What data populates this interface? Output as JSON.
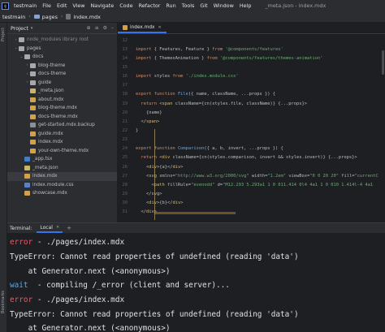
{
  "menubar": {
    "items": [
      "testmain",
      "File",
      "Edit",
      "View",
      "Navigate",
      "Code",
      "Refactor",
      "Run",
      "Tools",
      "Git",
      "Window",
      "Help"
    ],
    "title": "_meta.json - index.mdx"
  },
  "breadcrumb": {
    "items": [
      "testmain",
      "pages",
      "index.mdx"
    ]
  },
  "tool_strip": {
    "top_label": "Project",
    "bottom_label": "Bookmarks"
  },
  "project_panel": {
    "title": "Project",
    "tree": [
      {
        "indent": 1,
        "arrow": "›",
        "icon": "folder-icon",
        "label": "node_modules  library root",
        "dim": true
      },
      {
        "indent": 1,
        "arrow": "⌄",
        "icon": "folder-icon",
        "label": "pages"
      },
      {
        "indent": 2,
        "arrow": "⌄",
        "icon": "folder-icon",
        "label": "docs"
      },
      {
        "indent": 3,
        "arrow": "›",
        "icon": "folder-icon",
        "label": "blog-theme"
      },
      {
        "indent": 3,
        "arrow": "›",
        "icon": "folder-icon",
        "label": "docs-theme"
      },
      {
        "indent": 3,
        "arrow": "›",
        "icon": "folder-icon",
        "label": "guide"
      },
      {
        "indent": 3,
        "arrow": "",
        "icon": "json-icon",
        "label": "_meta.json"
      },
      {
        "indent": 3,
        "arrow": "",
        "icon": "mdx-icon",
        "label": "about.mdx"
      },
      {
        "indent": 3,
        "arrow": "",
        "icon": "mdx-icon",
        "label": "blog-theme.mdx"
      },
      {
        "indent": 3,
        "arrow": "",
        "icon": "mdx-icon",
        "label": "docs-theme.mdx"
      },
      {
        "indent": 3,
        "arrow": "",
        "icon": "backup-icon",
        "label": "get-started.mdx.backup"
      },
      {
        "indent": 3,
        "arrow": "",
        "icon": "mdx-icon",
        "label": "guide.mdx"
      },
      {
        "indent": 3,
        "arrow": "",
        "icon": "mdx-icon",
        "label": "index.mdx"
      },
      {
        "indent": 3,
        "arrow": "",
        "icon": "mdx-icon",
        "label": "your-own-theme.mdx"
      },
      {
        "indent": 2,
        "arrow": "",
        "icon": "ts-icon",
        "label": "_app.tsx"
      },
      {
        "indent": 2,
        "arrow": "",
        "icon": "json-icon",
        "label": "_meta.json"
      },
      {
        "indent": 2,
        "arrow": "",
        "icon": "mdx-icon",
        "label": "index.mdx",
        "selected": true
      },
      {
        "indent": 2,
        "arrow": "",
        "icon": "css-icon",
        "label": "index.module.css"
      },
      {
        "indent": 2,
        "arrow": "",
        "icon": "mdx-icon",
        "label": "showcase.mdx"
      }
    ]
  },
  "editor": {
    "tab_label": "index.mdx",
    "lines": [
      {
        "n": "12",
        "tokens": []
      },
      {
        "n": "13",
        "tokens": [
          {
            "c": "tok-kw",
            "t": "import "
          },
          {
            "c": "",
            "t": "{ Features, Feature } "
          },
          {
            "c": "tok-kw",
            "t": "from "
          },
          {
            "c": "tok-str",
            "t": "'@components/features'"
          }
        ]
      },
      {
        "n": "14",
        "tokens": [
          {
            "c": "tok-kw",
            "t": "import "
          },
          {
            "c": "",
            "t": "{ ThemesAnimation } "
          },
          {
            "c": "tok-kw",
            "t": "from "
          },
          {
            "c": "tok-str",
            "t": "'@components/features/themes-animation'"
          }
        ]
      },
      {
        "n": "15",
        "tokens": []
      },
      {
        "n": "16",
        "tokens": [
          {
            "c": "tok-kw",
            "t": "import "
          },
          {
            "c": "",
            "t": "styles "
          },
          {
            "c": "tok-kw",
            "t": "from "
          },
          {
            "c": "tok-str",
            "t": "'./index.module.css'"
          }
        ]
      },
      {
        "n": "17",
        "tokens": []
      },
      {
        "n": "18",
        "tokens": [
          {
            "c": "tok-kw",
            "t": "export function "
          },
          {
            "c": "tok-fn",
            "t": "File"
          },
          {
            "c": "",
            "t": "({ name, className, ...props }) {"
          }
        ]
      },
      {
        "n": "19",
        "tokens": [
          {
            "c": "tok-kw",
            "t": "  return "
          },
          {
            "c": "",
            "t": "<"
          },
          {
            "c": "tok-tag",
            "t": "span "
          },
          {
            "c": "tok-attr",
            "t": "className"
          },
          {
            "c": "",
            "t": "={cn(styles.file, className)} {...props}>"
          }
        ]
      },
      {
        "n": "20",
        "tokens": [
          {
            "c": "",
            "t": "    {name}"
          }
        ]
      },
      {
        "n": "21",
        "tokens": [
          {
            "c": "",
            "t": "  </"
          },
          {
            "c": "tok-tag",
            "t": "span"
          },
          {
            "c": "",
            "t": ">"
          }
        ]
      },
      {
        "n": "22",
        "tokens": [
          {
            "c": "",
            "t": "}"
          }
        ]
      },
      {
        "n": "23",
        "tokens": []
      },
      {
        "n": "24",
        "tokens": [
          {
            "c": "tok-kw",
            "t": "export function "
          },
          {
            "c": "tok-fn",
            "t": "Comparison"
          },
          {
            "c": "",
            "t": "({ a, b, invert, ...props }) {"
          }
        ]
      },
      {
        "n": "25",
        "tokens": [
          {
            "c": "tok-kw",
            "t": "  return "
          },
          {
            "c": "",
            "t": "<"
          },
          {
            "c": "tok-tag",
            "t": "div "
          },
          {
            "c": "tok-attr",
            "t": "className"
          },
          {
            "c": "",
            "t": "={cn(styles.comparison, invert && styles.invert)} {...props}>"
          }
        ]
      },
      {
        "n": "26",
        "tokens": [
          {
            "c": "",
            "t": "    <"
          },
          {
            "c": "tok-tag",
            "t": "div"
          },
          {
            "c": "",
            "t": ">{a}</"
          },
          {
            "c": "tok-tag",
            "t": "div"
          },
          {
            "c": "",
            "t": ">"
          }
        ]
      },
      {
        "n": "27",
        "tokens": [
          {
            "c": "",
            "t": "    <"
          },
          {
            "c": "tok-tag",
            "t": "svg "
          },
          {
            "c": "tok-attr",
            "t": "xmlns"
          },
          {
            "c": "",
            "t": "="
          },
          {
            "c": "tok-str",
            "t": "\"http://www.w3.org/2000/svg\" "
          },
          {
            "c": "tok-attr",
            "t": "width"
          },
          {
            "c": "",
            "t": "="
          },
          {
            "c": "tok-str",
            "t": "\"1.2em\" "
          },
          {
            "c": "tok-attr",
            "t": "viewBox"
          },
          {
            "c": "",
            "t": "="
          },
          {
            "c": "tok-str",
            "t": "\"0 0 20 20\" "
          },
          {
            "c": "tok-attr",
            "t": "fill"
          },
          {
            "c": "",
            "t": "="
          },
          {
            "c": "tok-str",
            "t": "\"currentC"
          }
        ]
      },
      {
        "n": "28",
        "tokens": [
          {
            "c": "",
            "t": "      <"
          },
          {
            "c": "tok-tag",
            "t": "path "
          },
          {
            "c": "tok-attr",
            "t": "fillRule"
          },
          {
            "c": "",
            "t": "="
          },
          {
            "c": "tok-str",
            "t": "\"evenodd\" "
          },
          {
            "c": "tok-attr",
            "t": "d"
          },
          {
            "c": "",
            "t": "="
          },
          {
            "c": "tok-str",
            "t": "\"M12.293 5.293a1 1 0 011.414 0l4 4a1 1 0 010 1.414l-4 4a1"
          }
        ]
      },
      {
        "n": "29",
        "tokens": [
          {
            "c": "",
            "t": "    </"
          },
          {
            "c": "tok-tag",
            "t": "svg"
          },
          {
            "c": "",
            "t": ">"
          }
        ]
      },
      {
        "n": "30",
        "tokens": [
          {
            "c": "",
            "t": "    <"
          },
          {
            "c": "tok-tag",
            "t": "div"
          },
          {
            "c": "",
            "t": ">{b}</"
          },
          {
            "c": "tok-tag",
            "t": "div"
          },
          {
            "c": "",
            "t": ">"
          }
        ]
      },
      {
        "n": "31",
        "tokens": [
          {
            "c": "",
            "t": "  </"
          },
          {
            "c": "tok-tag",
            "t": "div"
          },
          {
            "c": "",
            "t": ">"
          }
        ]
      }
    ]
  },
  "terminal": {
    "title": "Terminal:",
    "tab_label": "Local",
    "lines": [
      [
        {
          "c": "t-error",
          "t": "error"
        },
        {
          "c": "",
          "t": " - ./pages/index.mdx"
        }
      ],
      [
        {
          "c": "",
          "t": "TypeError: Cannot read properties of undefined (reading 'data')"
        }
      ],
      [
        {
          "c": "",
          "t": "    at Generator.next (<anonymous>)"
        }
      ],
      [
        {
          "c": "t-wait",
          "t": "wait"
        },
        {
          "c": "",
          "t": "  - compiling /_error (client and server)..."
        }
      ],
      [
        {
          "c": "t-error",
          "t": "error"
        },
        {
          "c": "",
          "t": " - ./pages/index.mdx"
        }
      ],
      [
        {
          "c": "",
          "t": "TypeError: Cannot read properties of undefined (reading 'data')"
        }
      ],
      [
        {
          "c": "",
          "t": "    at Generator.next (<anonymous>)"
        }
      ]
    ]
  }
}
